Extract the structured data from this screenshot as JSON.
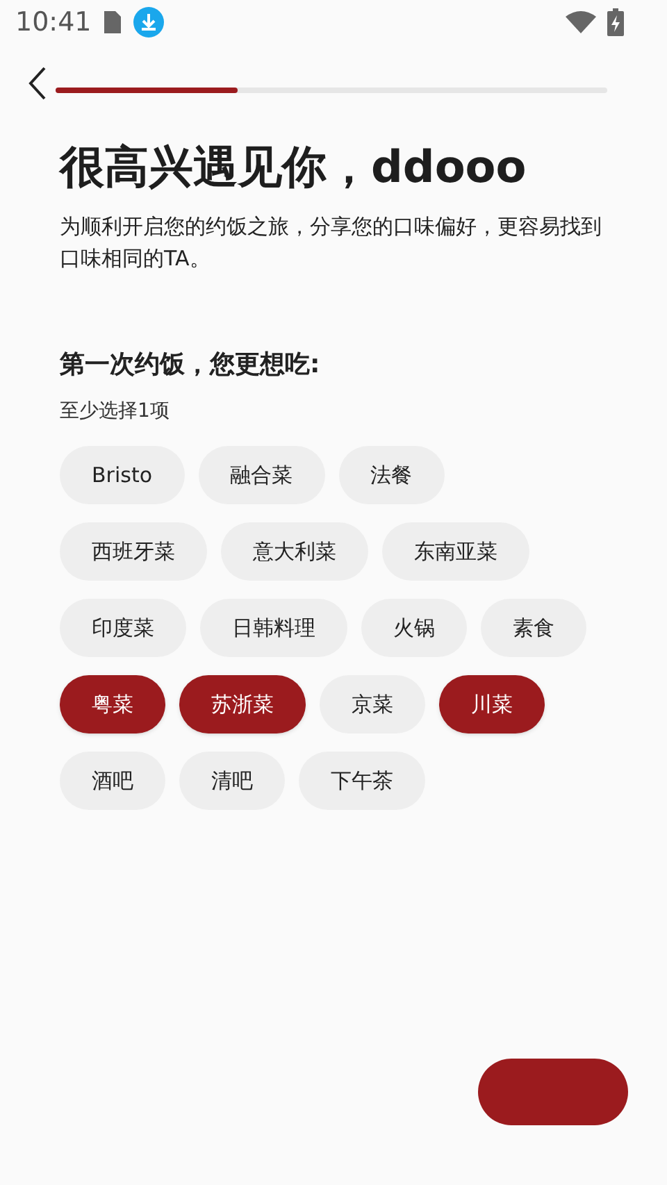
{
  "status_bar": {
    "time": "10:41"
  },
  "progress": {
    "level": 0.33
  },
  "title": "很高兴遇见你，ddooo",
  "subtitle": "为顺利开启您的约饭之旅，分享您的口味偏好，更容易找到口味相同的TA。",
  "question": "第一次约饭，您更想吃:",
  "hint": "至少选择1项",
  "tag_rows": [
    [
      {
        "label": "Bristo",
        "selected": false
      },
      {
        "label": "融合菜",
        "selected": false
      },
      {
        "label": "法餐",
        "selected": false
      }
    ],
    [
      {
        "label": "西班牙菜",
        "selected": false
      },
      {
        "label": "意大利菜",
        "selected": false
      },
      {
        "label": "东南亚菜",
        "selected": false
      }
    ],
    [
      {
        "label": "印度菜",
        "selected": false
      },
      {
        "label": "日韩料理",
        "selected": false
      },
      {
        "label": "火锅",
        "selected": false
      },
      {
        "label": "素食",
        "selected": false
      }
    ],
    [
      {
        "label": "粤菜",
        "selected": true
      },
      {
        "label": "苏浙菜",
        "selected": true
      },
      {
        "label": "京菜",
        "selected": false
      },
      {
        "label": "川菜",
        "selected": true
      }
    ],
    [
      {
        "label": "酒吧",
        "selected": false
      },
      {
        "label": "清吧",
        "selected": false
      },
      {
        "label": "下午茶",
        "selected": false
      }
    ]
  ]
}
